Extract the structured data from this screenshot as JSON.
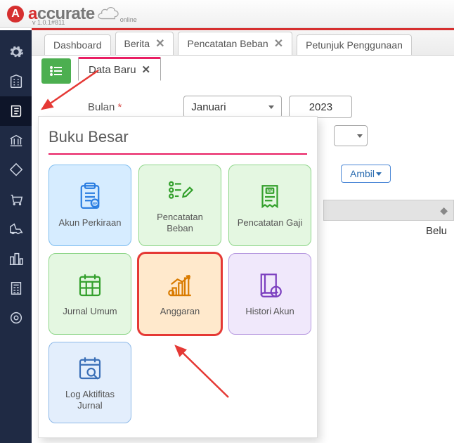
{
  "app": {
    "name_colored_prefix": "a",
    "name_rest": "ccurate",
    "sublabel": "online",
    "version": "v 1.0.1#811"
  },
  "tabs": [
    {
      "label": "Dashboard",
      "closable": false
    },
    {
      "label": "Berita",
      "closable": true
    },
    {
      "label": "Pencatatan Beban",
      "closable": true
    },
    {
      "label": "Petunjuk Penggunaan",
      "closable": false
    }
  ],
  "subtab": {
    "label": "Data Baru"
  },
  "form": {
    "month_label": "Bulan",
    "month_value": "Januari",
    "year_value": "2023",
    "ambil_label": "Ambil",
    "overflow_text": "Belu"
  },
  "panel": {
    "title": "Buku Besar",
    "tiles": [
      {
        "key": "akun",
        "label": "Akun Perkiraan",
        "theme": "t-blue",
        "icon": "clipboard-rp"
      },
      {
        "key": "beban",
        "label": "Pencatatan Beban",
        "theme": "t-green",
        "icon": "list-pen"
      },
      {
        "key": "gaji",
        "label": "Pencatatan Gaji",
        "theme": "t-green",
        "icon": "receipt-rp"
      },
      {
        "key": "jurnal",
        "label": "Jurnal Umum",
        "theme": "t-green",
        "icon": "calendar-grid"
      },
      {
        "key": "anggaran",
        "label": "Anggaran",
        "theme": "t-orange",
        "icon": "bar-chart"
      },
      {
        "key": "histori",
        "label": "Histori Akun",
        "theme": "t-purple",
        "icon": "book-clock"
      },
      {
        "key": "log",
        "label": "Log Aktifitas Jurnal",
        "theme": "t-blue2",
        "icon": "calendar-search"
      }
    ]
  },
  "sidebar_icons": [
    "gear",
    "building",
    "book",
    "bank",
    "tag",
    "cart",
    "dolly",
    "city",
    "calculator",
    "target"
  ]
}
